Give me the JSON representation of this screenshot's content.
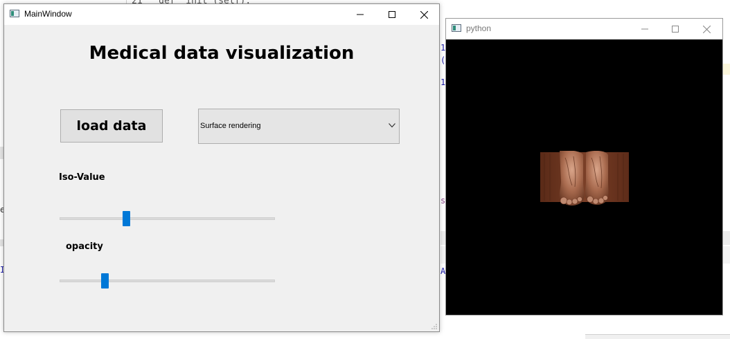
{
  "background": {
    "code_fragment": "21   def  init (self):",
    "side_chars": [
      "1",
      "(",
      "1",
      "s",
      "A",
      "e",
      "I"
    ]
  },
  "main_window": {
    "title": "MainWindow",
    "heading": "Medical data visualization",
    "load_button_label": "load data",
    "render_mode": {
      "selected": "Surface rendering"
    },
    "iso_value": {
      "label": "Iso-Value",
      "position_fraction": 0.31
    },
    "opacity": {
      "label": "opacity",
      "position_fraction": 0.21
    },
    "accent_color": "#0078d7"
  },
  "render_window": {
    "title": "python",
    "background_color": "#000000",
    "render_content": "volume-rendered feet"
  }
}
